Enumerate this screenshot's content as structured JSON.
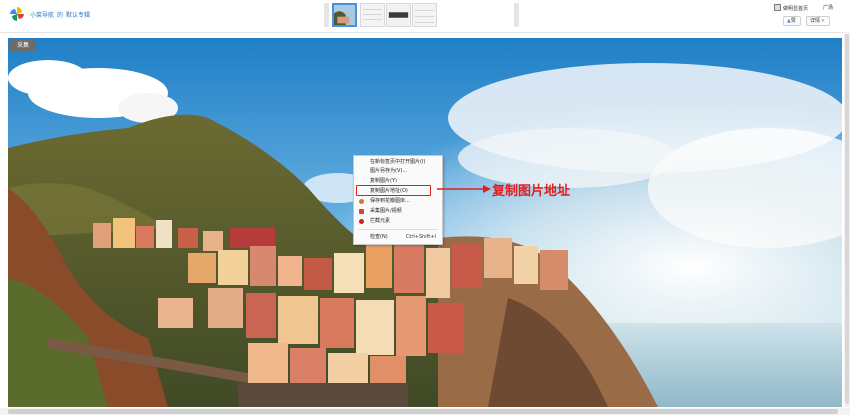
{
  "header": {
    "breadcrumb": [
      "小菜导航",
      "的",
      "默认专辑"
    ]
  },
  "toolbar_right": {
    "follow_label": "做明显首页",
    "ad_label": "广场",
    "like_label": "赞",
    "detail_label": "详情"
  },
  "photo": {
    "collect_label": "采集"
  },
  "context_menu": {
    "items": [
      {
        "label": "在新标签页中打开图片(I)",
        "icon": ""
      },
      {
        "label": "图片另存为(V)...",
        "icon": ""
      },
      {
        "label": "复制图片(Y)",
        "icon": ""
      },
      {
        "label": "复制图片地址(O)",
        "icon": "",
        "highlighted": true
      },
      {
        "label": "保存到花瓣图床...",
        "icon": "huaban-icon"
      },
      {
        "label": "采集图片/视频",
        "icon": "collect-icon"
      },
      {
        "label": "拦截元素",
        "icon": "block-icon"
      },
      {
        "label": "检查(N)",
        "icon": "",
        "shortcut": "Ctrl+Shift+I"
      }
    ]
  },
  "annotation": {
    "text": "复制图片地址",
    "color": "#e01e1e"
  },
  "colors": {
    "accent": "#4a90e2",
    "link": "#2b74c9"
  }
}
